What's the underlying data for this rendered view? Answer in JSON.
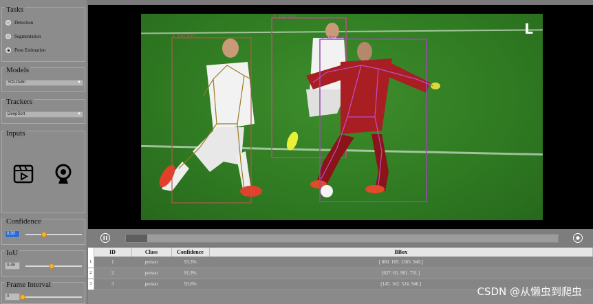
{
  "sidebar": {
    "tasks": {
      "title": "Tasks",
      "options": [
        {
          "label": "Detection",
          "selected": false
        },
        {
          "label": "Segmentation",
          "selected": false
        },
        {
          "label": "Pose Estimation",
          "selected": true
        }
      ]
    },
    "models": {
      "title": "Models",
      "selected": "YOLOv8n"
    },
    "trackers": {
      "title": "Trackers",
      "selected": "DeepSort"
    },
    "inputs": {
      "title": "Inputs",
      "icons": [
        "video-file-icon",
        "webcam-icon"
      ]
    },
    "confidence": {
      "title": "Confidence",
      "value": "0.30"
    },
    "iou": {
      "title": "IoU",
      "value": "0.45"
    },
    "frame_interval": {
      "title": "Frame Interval",
      "value": "0"
    }
  },
  "video": {
    "detections_overlay": [
      {
        "label": "1 person",
        "color": "#b05a4a"
      },
      {
        "label": "2 person",
        "color": "#c04a8a"
      },
      {
        "label": "3 person",
        "color": "#9a4ab0"
      }
    ],
    "logo": "L"
  },
  "controls": {
    "play_icon": "pause-icon",
    "stop_icon": "record-icon",
    "progress": 0.05
  },
  "table": {
    "headers": [
      "ID",
      "Class",
      "Confidence",
      "BBox"
    ],
    "rows": [
      {
        "n": "1",
        "id": "1",
        "cls": "person",
        "conf": "93.3%",
        "bbox": "[ 860.  169. 1365.  940.]"
      },
      {
        "n": "2",
        "id": "2",
        "cls": "person",
        "conf": "91.9%",
        "bbox": "[627.  65. 981. 731.]"
      },
      {
        "n": "3",
        "id": "3",
        "cls": "person",
        "conf": "93.6%",
        "bbox": "[145. 162. 524. 946.]"
      }
    ]
  },
  "watermark": "CSDN @从懒虫到爬虫"
}
